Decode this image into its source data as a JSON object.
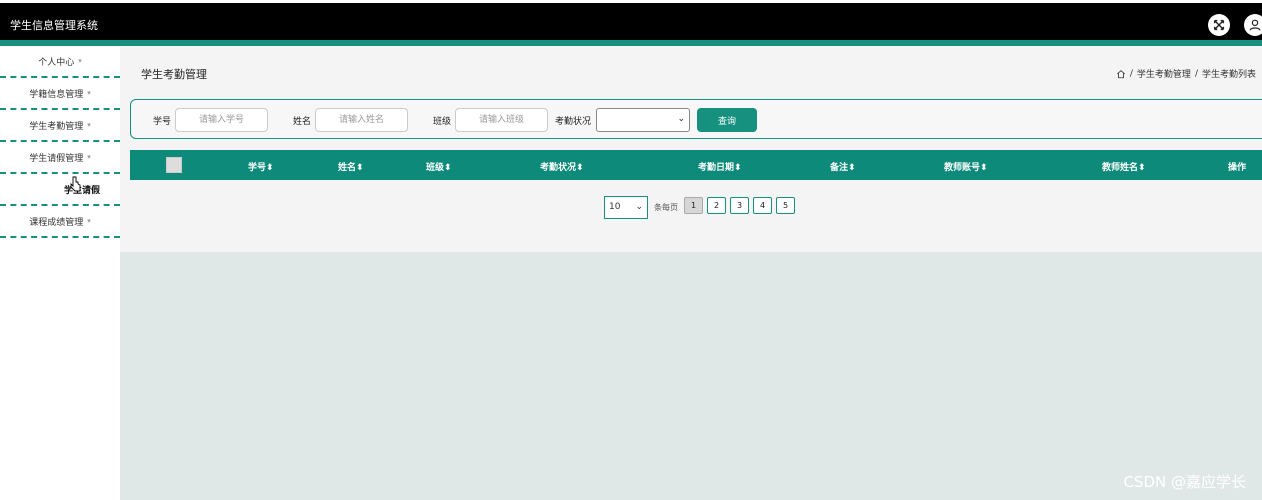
{
  "app": {
    "title": "学生信息管理系统"
  },
  "header_icons": [
    "fullscreen-icon",
    "user-icon"
  ],
  "sidebar": {
    "items": [
      {
        "label": "个人中心",
        "caret": "▾"
      },
      {
        "label": "学籍信息管理",
        "caret": "▾"
      },
      {
        "label": "学生考勤管理",
        "caret": "▾"
      },
      {
        "label": "学生请假管理",
        "caret": "▾"
      },
      {
        "label": "学生请假",
        "sub": true
      },
      {
        "label": "课程成绩管理",
        "caret": "▾"
      }
    ]
  },
  "page": {
    "title": "学生考勤管理",
    "breadcrumb": [
      "学生考勤管理",
      "学生考勤列表"
    ],
    "breadcrumb_sep": "/"
  },
  "search": {
    "student_id_label": "学号",
    "student_id_placeholder": "请输入学号",
    "name_label": "姓名",
    "name_placeholder": "请输入姓名",
    "class_label": "班级",
    "class_placeholder": "请输入班级",
    "status_label": "考勤状况",
    "status_value": "",
    "button": "查询"
  },
  "table": {
    "columns": [
      "学号",
      "姓名",
      "班级",
      "考勤状况",
      "考勤日期",
      "备注",
      "教师账号",
      "教师姓名",
      "操作"
    ],
    "sort_icon": "⬍"
  },
  "pagination": {
    "page_size": "10",
    "per_page_label": "条每页",
    "pages": [
      "1",
      "2",
      "3",
      "4",
      "5"
    ],
    "active_page": "1"
  },
  "watermark": "CSDN @嘉应学长",
  "colors": {
    "accent": "#16907f",
    "header": "#000000",
    "table_header": "#0d8a7a"
  }
}
